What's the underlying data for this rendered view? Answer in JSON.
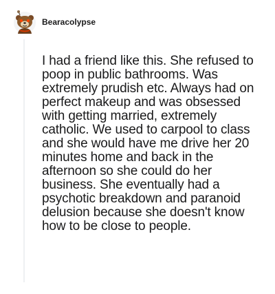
{
  "comment": {
    "author": "Bearacolypse",
    "avatar_icon": "snoo-avatar-icon",
    "body": "I had a friend like this. She refused to poop in public bathrooms. Was extremely prudish etc. Always had on perfect makeup and was obsessed with getting married, extremely catholic. We used to carpool to class and she would have me drive her 20 minutes home and back in the afternoon so she could do her business. She eventually had a psychotic breakdown and paranoid delusion because she doesn't know how to be close to people."
  },
  "colors": {
    "text": "#1a1a1b",
    "thread_line": "#eef0f2",
    "avatar_bg": "#f3f4f5"
  }
}
